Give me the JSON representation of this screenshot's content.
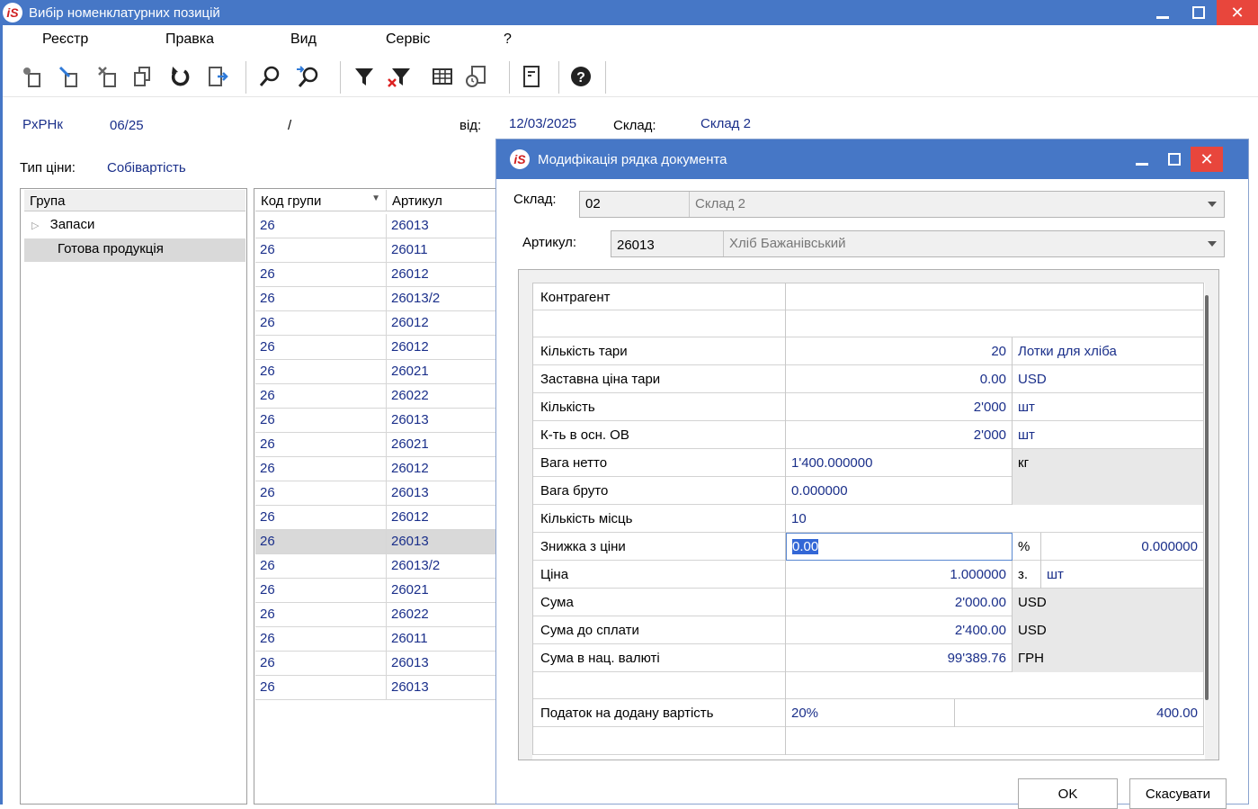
{
  "main_window": {
    "title": "Вибір номенклатурних позицій"
  },
  "menu": [
    "Реєстр",
    "Правка",
    "Вид",
    "Сервіс",
    "?"
  ],
  "toolbar_icons": [
    "new-icon",
    "edit-icon",
    "delete-icon",
    "copy-icon",
    "refresh-icon",
    "export-icon",
    "search-icon",
    "search-next-icon",
    "filter-icon",
    "clear-filter-icon",
    "table-icon",
    "history-icon",
    "document-icon",
    "help-icon"
  ],
  "header": {
    "doc_type": "РхРНк",
    "doc_number": "06/25",
    "separator": "/",
    "date_label": "від:",
    "date_value": "12/03/2025",
    "warehouse_label": "Склад:",
    "warehouse_value": "Склад 2",
    "price_type_label": "Тип ціни:",
    "price_type_value": "Собівартість"
  },
  "groups_panel": {
    "header": "Група",
    "items": [
      {
        "label": "Запаси",
        "expandable": true
      },
      {
        "label": "Готова продукція",
        "selected": true
      }
    ]
  },
  "items_grid": {
    "columns": [
      "Код групи",
      "Артикул"
    ],
    "rows": [
      [
        "26",
        "26013"
      ],
      [
        "26",
        "26011"
      ],
      [
        "26",
        "26012"
      ],
      [
        "26",
        "26013/2"
      ],
      [
        "26",
        "26012"
      ],
      [
        "26",
        "26012"
      ],
      [
        "26",
        "26021"
      ],
      [
        "26",
        "26022"
      ],
      [
        "26",
        "26013"
      ],
      [
        "26",
        "26021"
      ],
      [
        "26",
        "26012"
      ],
      [
        "26",
        "26013"
      ],
      [
        "26",
        "26012"
      ],
      [
        "26",
        "26013"
      ],
      [
        "26",
        "26013/2"
      ],
      [
        "26",
        "26021"
      ],
      [
        "26",
        "26022"
      ],
      [
        "26",
        "26011"
      ],
      [
        "26",
        "26013"
      ],
      [
        "26",
        "26013"
      ]
    ],
    "selected_row_index": 13
  },
  "dialog": {
    "title": "Модифікація рядка документа",
    "warehouse_label": "Склад:",
    "warehouse_code": "02",
    "warehouse_name": "Склад 2",
    "article_label": "Артикул:",
    "article_code": "26013",
    "article_name": "Хліб Бажанівський",
    "fields": {
      "counterparty_label": "Контрагент",
      "counterparty_value": "",
      "tare_qty_label": "Кількість тари",
      "tare_qty_value": "20",
      "tare_qty_unit": "Лотки для хліба",
      "tare_price_label": "Заставна ціна тари",
      "tare_price_value": "0.00",
      "tare_price_currency": "USD",
      "qty_label": "Кількість",
      "qty_value": "2'000",
      "qty_unit": "шт",
      "qty_base_label": "К-ть в осн. ОВ",
      "qty_base_value": "2'000",
      "qty_base_unit": "шт",
      "net_weight_label": "Вага нетто",
      "net_weight_value": "1'400.000000",
      "net_weight_unit": "кг",
      "gross_weight_label": "Вага бруто",
      "gross_weight_value": "0.000000",
      "places_label": "Кількість місць",
      "places_value": "10",
      "discount_label": "Знижка з ціни",
      "discount_value": "0.00",
      "discount_unit": "%",
      "discount_amount": "0.000000",
      "price_label": "Ціна",
      "price_value": "1.000000",
      "price_per": "з.",
      "price_unit": "шт",
      "sum_label": "Сума",
      "sum_value": "2'000.00",
      "sum_currency": "USD",
      "sum_to_pay_label": "Сума до сплати",
      "sum_to_pay_value": "2'400.00",
      "sum_to_pay_currency": "USD",
      "sum_national_label": "Сума в нац. валюті",
      "sum_national_value": "99'389.76",
      "sum_national_currency": "ГРН",
      "vat_label": "Податок на додану вартість",
      "vat_rate": "20%",
      "vat_amount": "400.00"
    },
    "ok_label": "OK",
    "cancel_label": "Скасувати"
  }
}
